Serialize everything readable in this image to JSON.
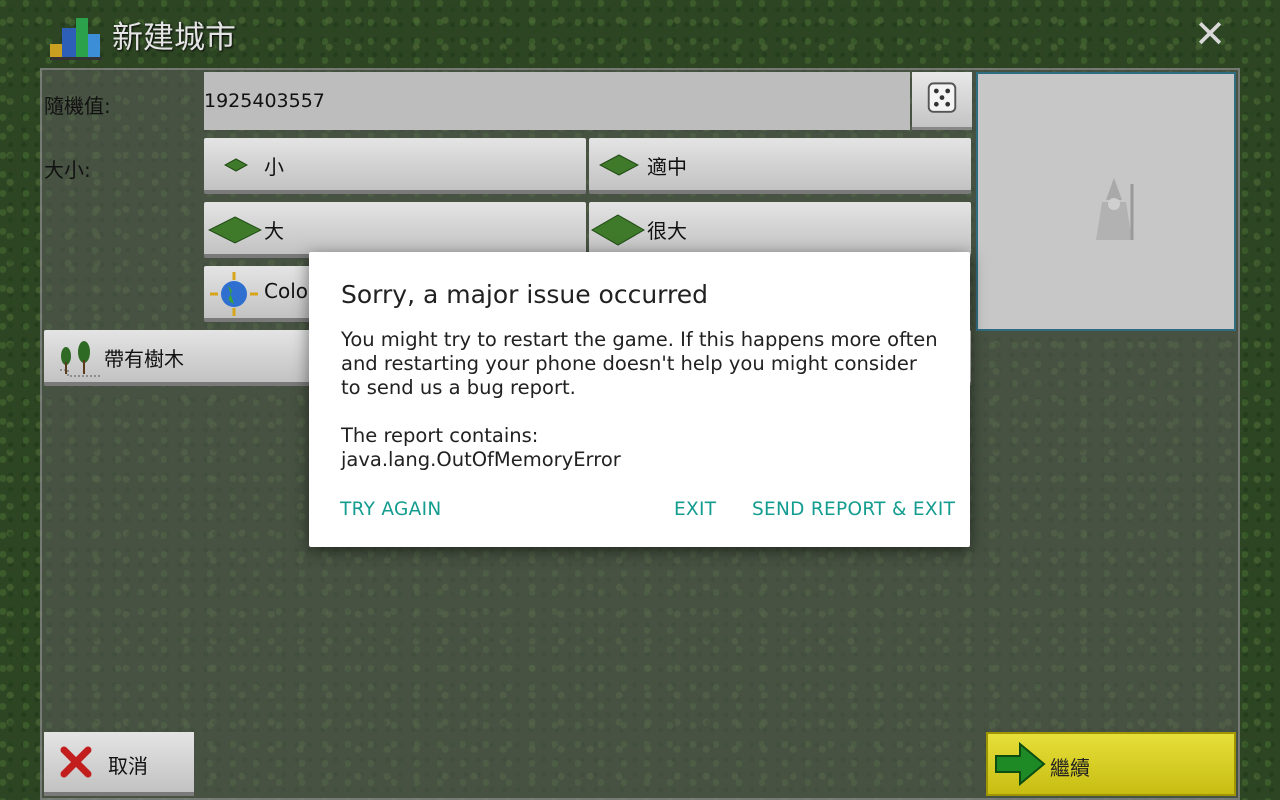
{
  "header": {
    "title": "新建城市",
    "app_icon": "city-buildings-icon",
    "close_icon": "close-icon",
    "close_glyph": "✕"
  },
  "form": {
    "seed_label": "隨機值:",
    "seed_value": "1925403557",
    "size_label": "大小:",
    "sizes": [
      {
        "label": "小",
        "icon": "small-map-icon"
      },
      {
        "label": "適中",
        "icon": "medium-map-icon"
      },
      {
        "label": "大",
        "icon": "large-map-icon"
      },
      {
        "label": "很大",
        "icon": "very-large-map-icon"
      },
      {
        "label": "Colos",
        "icon": "globe-icon"
      }
    ],
    "trees_label": "帶有樹木"
  },
  "footer": {
    "cancel_label": "取消",
    "continue_label": "繼續"
  },
  "dialog": {
    "title": "Sorry, a major issue occurred",
    "message": "You might try to restart the game. If this happens more often and restarting your phone doesn't help you might consider to send us a bug report.",
    "report_line1": "The report contains:",
    "report_line2": "java.lang.OutOfMemoryError",
    "try_again": "TRY AGAIN",
    "exit": "EXIT",
    "send_report": "SEND REPORT & EXIT"
  },
  "colors": {
    "accent": "#139c8f",
    "continue_bg": "#e7df3a",
    "preview_border": "#2f6c80"
  }
}
